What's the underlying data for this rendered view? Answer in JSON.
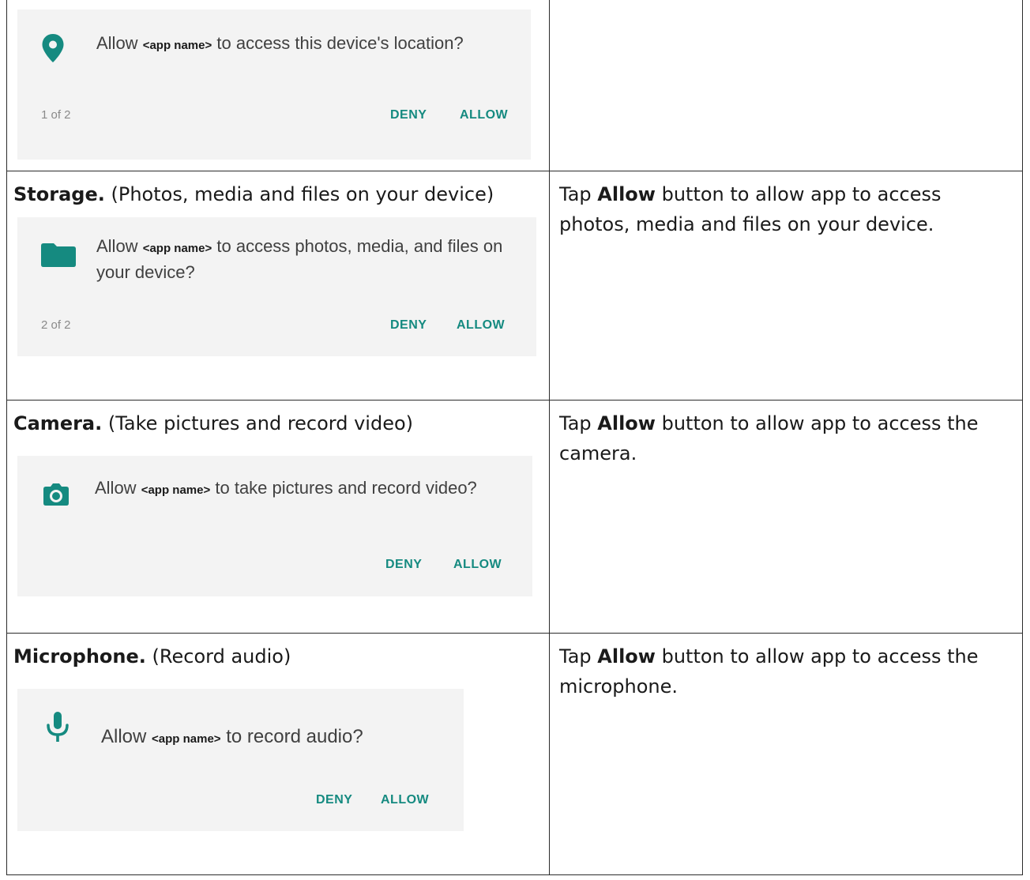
{
  "rows": [
    {
      "dialog": {
        "msg_prefix": "Allow",
        "app_name": "<app name>",
        "msg_suffix": "to access this device's location?",
        "counter": "1 of 2",
        "deny": "DENY",
        "allow": "ALLOW",
        "icon": "location-pin-icon"
      }
    },
    {
      "heading_bold": "Storage.",
      "heading_rest": " (Photos, media and files on your device)",
      "dialog": {
        "msg_prefix": "Allow",
        "app_name": "<app name>",
        "msg_suffix": "to access photos, media, and files on your device?",
        "counter": "2 of 2",
        "deny": "DENY",
        "allow": "ALLOW",
        "icon": "folder-icon"
      },
      "right_prefix": "Tap ",
      "right_bold": "Allow",
      "right_suffix": " button to allow app to access photos, media and files on your device."
    },
    {
      "heading_bold": "Camera.",
      "heading_rest": " (Take pictures and record video)",
      "dialog": {
        "msg_prefix": "Allow",
        "app_name": "<app name>",
        "msg_suffix": "to take pictures and record video?",
        "deny": "DENY",
        "allow": "ALLOW",
        "icon": "camera-icon"
      },
      "right_prefix": "Tap ",
      "right_bold": "Allow",
      "right_suffix": " button to allow app to access the camera."
    },
    {
      "heading_bold": "Microphone.",
      "heading_rest": " (Record audio)",
      "dialog": {
        "msg_prefix": "Allow",
        "app_name": "<app name>",
        "msg_suffix": "to record audio?",
        "deny": "DENY",
        "allow": "ALLOW",
        "icon": "microphone-icon"
      },
      "right_prefix": "Tap ",
      "right_bold": "Allow",
      "right_suffix": " button to allow app to access the microphone."
    }
  ],
  "colors": {
    "accent": "#158a80",
    "dialog_bg": "#f3f3f3",
    "border": "#2b2b2b"
  }
}
